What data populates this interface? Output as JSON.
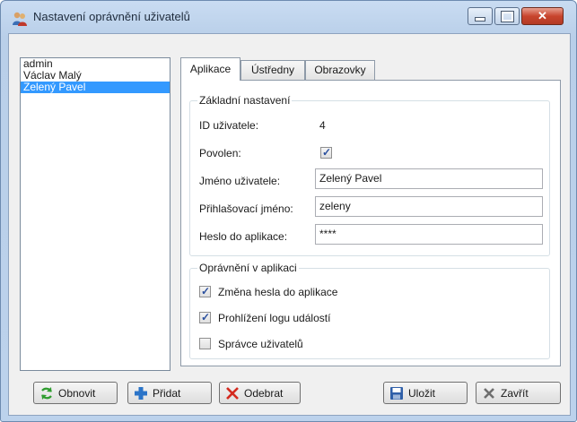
{
  "window": {
    "title": "Nastavení oprávnění uživatelů"
  },
  "users": [
    "admin",
    "Václav Malý",
    "Zelený Pavel"
  ],
  "tabs": [
    "Aplikace",
    "Ústředny",
    "Obrazovky"
  ],
  "basic": {
    "title": "Základní nastavení",
    "id_label": "ID uživatele:",
    "id_value": "4",
    "enabled_label": "Povolen:",
    "enabled_checked": true,
    "name_label": "Jméno uživatele:",
    "name_value": "Zelený Pavel",
    "login_label": "Přihlašovací jméno:",
    "login_value": "zeleny",
    "password_label": "Heslo do aplikace:",
    "password_value": "****"
  },
  "permissions": {
    "title": "Oprávnění v aplikaci",
    "items": [
      {
        "label": "Změna hesla do aplikace",
        "checked": true
      },
      {
        "label": "Prohlížení logu událostí",
        "checked": true
      },
      {
        "label": "Správce uživatelů",
        "checked": false
      }
    ]
  },
  "buttons": {
    "refresh": "Obnovit",
    "add": "Přidat",
    "remove": "Odebrat",
    "save": "Uložit",
    "close": "Zavřít"
  }
}
